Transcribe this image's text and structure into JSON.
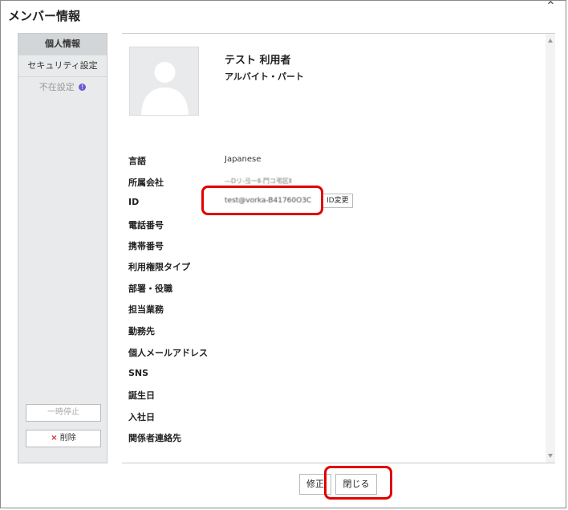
{
  "dialog": {
    "title": "メンバー情報",
    "close_glyph": "⌃"
  },
  "sidebar": {
    "tabs": [
      {
        "label": "個人情報",
        "state": "active"
      },
      {
        "label": "セキュリティ設定",
        "state": "normal"
      },
      {
        "label": "不在設定",
        "state": "disabled"
      }
    ],
    "info_badge": "!",
    "pause_label": "一時停止",
    "delete_label": "削除",
    "delete_glyph": "×"
  },
  "profile": {
    "name": "テスト 利用者",
    "role": "アルバイト・パート"
  },
  "fields": [
    {
      "label": "言語",
      "value": "Japanese"
    },
    {
      "label": "所属会社",
      "value": "―Dリ-弖一Ⅱ-鬥コ弔区Ⅱ"
    },
    {
      "label": "ID",
      "value": "test@vorka-B41760O3C"
    },
    {
      "label": "電話番号",
      "value": ""
    },
    {
      "label": "携帯番号",
      "value": ""
    },
    {
      "label": "利用権限タイプ",
      "value": ""
    },
    {
      "label": "部署・役職",
      "value": ""
    },
    {
      "label": "担当業務",
      "value": ""
    },
    {
      "label": "勤務先",
      "value": ""
    },
    {
      "label": "個人メールアドレス",
      "value": ""
    },
    {
      "label": "SNS",
      "value": ""
    },
    {
      "label": "誕生日",
      "value": ""
    },
    {
      "label": "入社日",
      "value": ""
    },
    {
      "label": "関係者連絡先",
      "value": ""
    }
  ],
  "id_change_label": "ID変更",
  "footer": {
    "edit_label": "修正",
    "close_label": "閉じる"
  },
  "colors": {
    "highlight": "#e00000",
    "sidebar_bg": "#e8eaeb",
    "delete_accent": "#d42c2c",
    "info_badge": "#6b5bd6"
  },
  "icons": {
    "avatar": "default-person-silhouette",
    "scroll_up": "triangle-up",
    "scroll_down": "triangle-down"
  }
}
